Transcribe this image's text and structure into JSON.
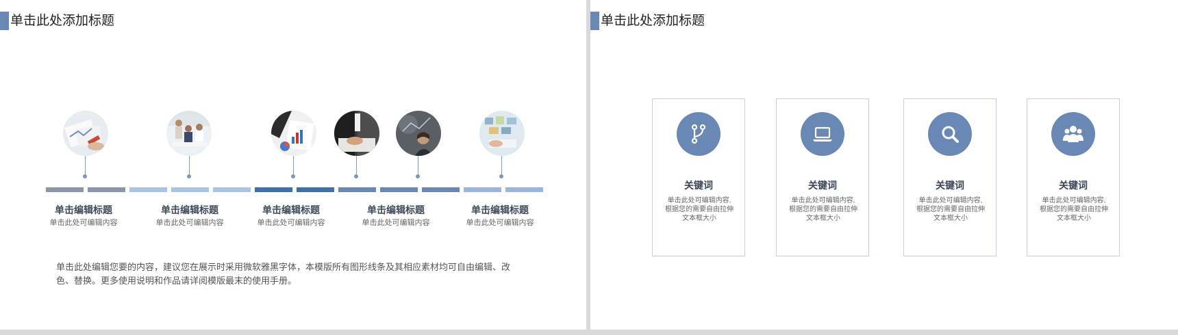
{
  "slides": [
    {
      "title": "单击此处添加标题",
      "timeline": [
        {
          "title": "单击编辑标题",
          "subtitle": "单击此处可编辑内容"
        },
        {
          "title": "单击编辑标题",
          "subtitle": "单击此处可编辑内容"
        },
        {
          "title": "单击编辑标题",
          "subtitle": "单击此处可编辑内容"
        },
        {
          "title": "单击编辑标题",
          "subtitle": "单击此处可编辑内容"
        },
        {
          "title": "单击编辑标题",
          "subtitle": "单击此处可编辑内容"
        }
      ],
      "segment_colors": [
        "#8b96a6",
        "#8b96a6",
        "#a9c3e4",
        "#a9c3e4",
        "#a9c3e4",
        "#3f6ea8",
        "#3f6ea8",
        "#6b86b0",
        "#6b86b0",
        "#6b86b0",
        "#9cb5dc",
        "#9cb5dc"
      ],
      "body": "单击此处编辑您要的内容，建议您在展示时采用微软雅黑字体，本模版所有图形线条及其相应素材均可自由编辑、改色、替换。更多使用说明和作品请详阅模版最末的使用手册。"
    },
    {
      "title": "单击此处添加标题",
      "cards": [
        {
          "icon": "branch-icon",
          "keyword": "关键词",
          "desc": "单击此处可编辑内容,根据您的需要自由拉伸文本框大小"
        },
        {
          "icon": "laptop-icon",
          "keyword": "关键词",
          "desc": "单击此处可编辑内容,根据您的需要自由拉伸文本框大小"
        },
        {
          "icon": "search-icon",
          "keyword": "关键词",
          "desc": "单击此处可编辑内容,根据您的需要自由拉伸文本框大小"
        },
        {
          "icon": "users-icon",
          "keyword": "关键词",
          "desc": "单击此处可编辑内容,根据您的需要自由拉伸文本框大小"
        }
      ]
    }
  ],
  "colors": {
    "accent": "#6a88b4",
    "card_border": "#c9ced8"
  }
}
